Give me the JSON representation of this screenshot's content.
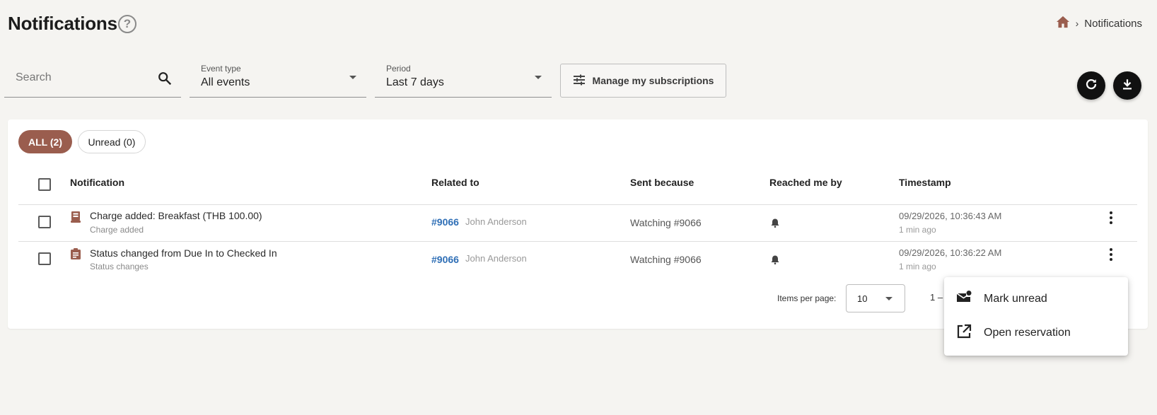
{
  "header": {
    "title": "Notifications",
    "help_glyph": "?"
  },
  "breadcrumb": {
    "home_icon": "home-icon",
    "current": "Notifications"
  },
  "filters": {
    "search": {
      "placeholder": "Search"
    },
    "event_type": {
      "label": "Event type",
      "value": "All events"
    },
    "period": {
      "label": "Period",
      "value": "Last 7 days"
    },
    "manage_label": "Manage my subscriptions"
  },
  "actions": {
    "refresh_icon": "refresh-icon",
    "download_icon": "download-icon"
  },
  "tabs": [
    {
      "label": "ALL (2)",
      "active": true
    },
    {
      "label": "Unread (0)",
      "active": false
    }
  ],
  "table": {
    "columns": [
      "Notification",
      "Related to",
      "Sent because",
      "Reached me by",
      "Timestamp"
    ],
    "rows": [
      {
        "icon": "receipt-icon",
        "title": "Charge added: Breakfast (THB 100.00)",
        "subtitle": "Charge added",
        "reservation": "#9066",
        "guest": "John Anderson",
        "sent_because": "Watching #9066",
        "reached_by_icon": "bell-icon",
        "timestamp": "09/29/2026, 10:36:43 AM",
        "relative": "1 min ago"
      },
      {
        "icon": "clipboard-icon",
        "title": "Status changed from Due In to Checked In",
        "subtitle": "Status changes",
        "reservation": "#9066",
        "guest": "John Anderson",
        "sent_because": "Watching #9066",
        "reached_by_icon": "bell-icon",
        "timestamp": "09/29/2026, 10:36:22 AM",
        "relative": "1 min ago"
      }
    ]
  },
  "pagination": {
    "items_per_page_label": "Items per page:",
    "items_per_page": "10",
    "range": "1 –"
  },
  "context_menu": {
    "items": [
      {
        "label": "Mark unread",
        "icon": "mark-unread-icon"
      },
      {
        "label": "Open reservation",
        "icon": "open-in-new-icon"
      }
    ]
  },
  "colors": {
    "accent": "#9a5d4e",
    "link": "#2f6fb6",
    "background": "#f5f4f1"
  }
}
